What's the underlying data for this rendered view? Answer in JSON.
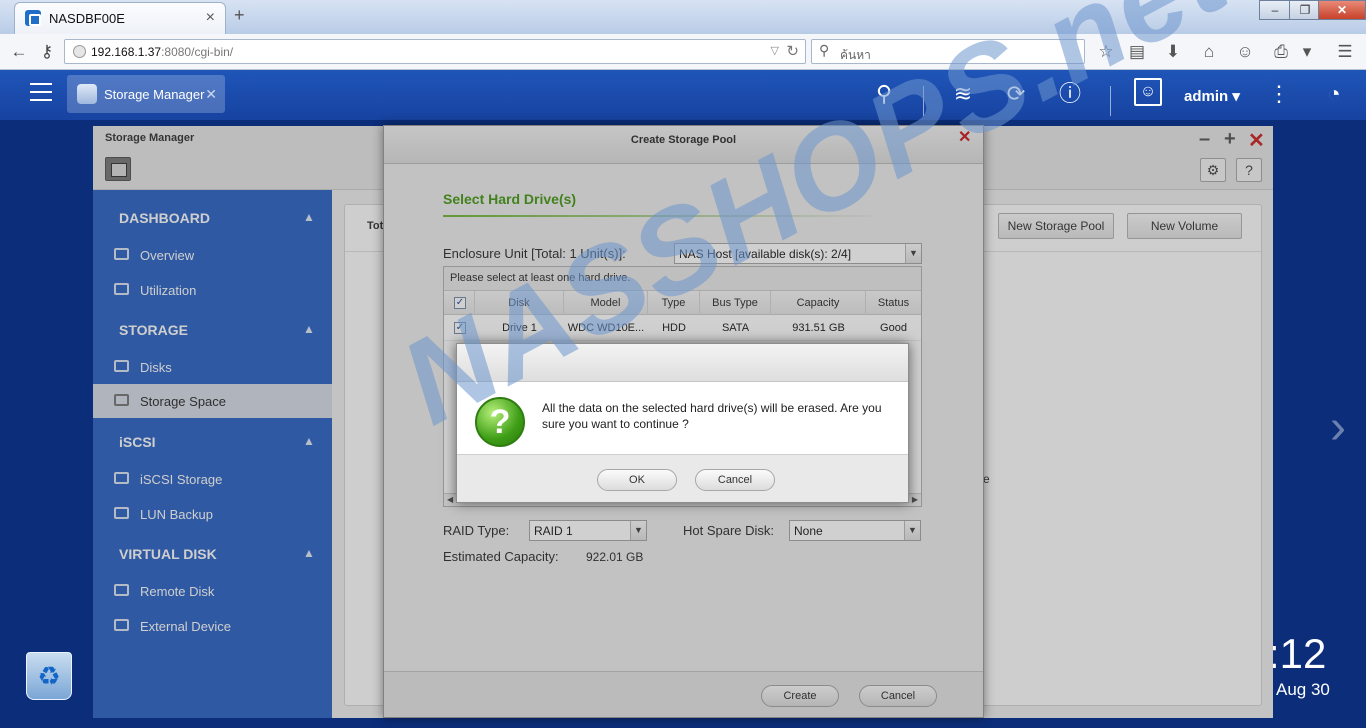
{
  "browser": {
    "tab_title": "NASDBF00E",
    "url_host": "192.168.1.37",
    "url_rest": ":8080/cgi-bin/",
    "search_placeholder": "ค้นหา"
  },
  "header": {
    "app_tab_label": "Storage Manager",
    "user_name": "admin ▾"
  },
  "window": {
    "title": "Storage Manager"
  },
  "sidebar": {
    "sections": [
      {
        "label": "DASHBOARD",
        "items": [
          "Overview",
          "Utilization"
        ]
      },
      {
        "label": "STORAGE",
        "items": [
          "Disks",
          "Storage Space"
        ]
      },
      {
        "label": "iSCSI",
        "items": [
          "iSCSI Storage",
          "LUN Backup"
        ]
      },
      {
        "label": "VIRTUAL DISK",
        "items": [
          "Remote Disk",
          "External Device"
        ]
      }
    ],
    "active_item": "Storage Space"
  },
  "content": {
    "tot_label": "Tot",
    "new_pool_button": "New Storage Pool",
    "new_volume_button": "New Volume",
    "partial_e": "e"
  },
  "create_pool": {
    "title": "Create Storage Pool",
    "heading": "Select Hard Drive(s)",
    "enclosure_label": "Enclosure Unit [Total: 1 Unit(s)]:",
    "enclosure_value": "NAS Host [available disk(s): 2/4]",
    "hint": "Please select at least one hard drive.",
    "columns": [
      "Disk",
      "Model",
      "Type",
      "Bus Type",
      "Capacity",
      "Status"
    ],
    "rows": [
      {
        "checked": true,
        "disk": "Drive 1",
        "model": "WDC WD10E...",
        "type": "HDD",
        "bus": "SATA",
        "capacity": "931.51 GB",
        "status": "Good"
      }
    ],
    "raid_label": "RAID Type:",
    "raid_value": "RAID 1",
    "hot_spare_label": "Hot Spare Disk:",
    "hot_spare_value": "None",
    "est_label": "Estimated Capacity:",
    "est_value": "922.01 GB",
    "create_button": "Create",
    "cancel_button": "Cancel"
  },
  "confirm": {
    "message": "All the data on the selected hard drive(s) will be erased. Are you sure you want to continue ?",
    "ok_button": "OK",
    "cancel_button": "Cancel"
  },
  "desktop": {
    "clock": ":12",
    "date": "Aug 30"
  },
  "watermark": "NASSHOPS.net"
}
